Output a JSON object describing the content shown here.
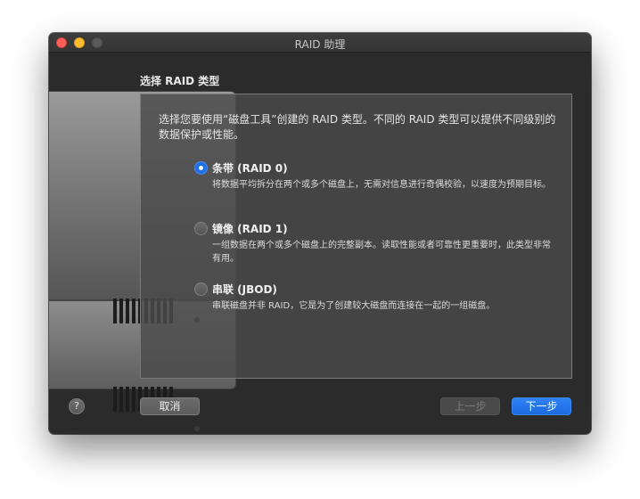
{
  "window": {
    "title": "RAID 助理"
  },
  "page": {
    "heading": "选择 RAID 类型",
    "intro": "选择您要使用“磁盘工具”创建的 RAID 类型。不同的 RAID 类型可以提供不同级别的数据保护或性能。"
  },
  "options": [
    {
      "title": "条带 (RAID 0)",
      "description": "将数据平均拆分在两个或多个磁盘上，无需对信息进行奇偶校验，以速度为预期目标。",
      "selected": true
    },
    {
      "title": "镜像 (RAID 1)",
      "description": "一组数据在两个或多个磁盘上的完整副本。读取性能或者可靠性更重要时，此类型非常有用。",
      "selected": false
    },
    {
      "title": "串联 (JBOD)",
      "description": "串联磁盘并非 RAID，它是为了创建较大磁盘而连接在一起的一组磁盘。",
      "selected": false
    }
  ],
  "buttons": {
    "help": "?",
    "cancel": "取消",
    "previous": "上一步",
    "next": "下一步"
  },
  "colors": {
    "accent": "#1e6fe8",
    "window_bg": "#2b2b2b",
    "close": "#fe5f57",
    "minimize": "#febc2e"
  }
}
